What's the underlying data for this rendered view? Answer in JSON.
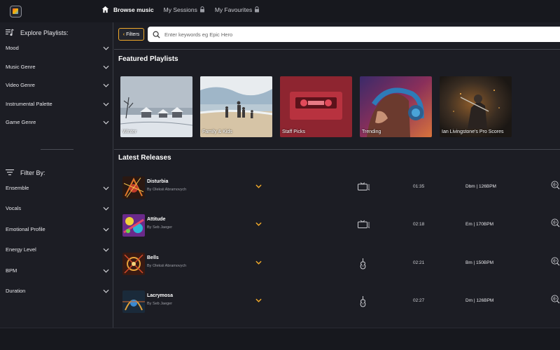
{
  "topnav": {
    "browse": "Browse music",
    "sessions": "My Sessions",
    "favourites": "My Favourites"
  },
  "sidebar": {
    "explore_title": "Explore Playlists:",
    "explore_items": [
      "Mood",
      "Music Genre",
      "Video Genre",
      "Instrumental Palette",
      "Game Genre"
    ],
    "filter_title": "Filter By:",
    "filter_items": [
      "Ensemble",
      "Vocals",
      "Emotional Profile",
      "Energy Level",
      "BPM",
      "Duration"
    ]
  },
  "search": {
    "filters_label": "Filters",
    "placeholder": "Enter keywords eg Epic Hero"
  },
  "featured": {
    "title": "Featured Playlists",
    "cards": [
      "Winter",
      "Family & Kids",
      "Staff Picks",
      "Trending",
      "Ian Livingstone's Pro Scores"
    ]
  },
  "latest": {
    "title": "Latest Releases",
    "tracks": [
      {
        "title": "Disturbia",
        "artist": "By Oleksii Abramovych",
        "instrument": "tv-icon",
        "duration": "01:35",
        "key_bpm": "Dbm | 126BPM"
      },
      {
        "title": "Attitude",
        "artist": "By Seb Jaeger",
        "instrument": "tv-icon",
        "duration": "02:18",
        "key_bpm": "Em | 170BPM"
      },
      {
        "title": "Bells",
        "artist": "By Oleksii Abramovych",
        "instrument": "violin-icon",
        "duration": "02:21",
        "key_bpm": "Bm | 150BPM"
      },
      {
        "title": "Lacrymosa",
        "artist": "By Seb Jaeger",
        "instrument": "violin-icon",
        "duration": "02:27",
        "key_bpm": "Dm | 126BPM"
      }
    ]
  },
  "colors": {
    "accent": "#f0a92a",
    "background": "#1c1d24",
    "topbar": "#17181e"
  }
}
